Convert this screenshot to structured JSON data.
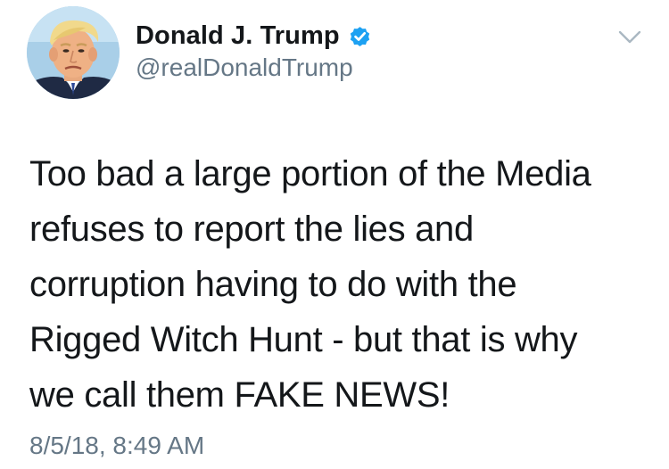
{
  "author": {
    "display_name": "Donald J. Trump",
    "handle": "@realDonaldTrump",
    "verified": true,
    "verified_icon": "verified-badge-icon",
    "avatar_icon": "profile-photo"
  },
  "menu": {
    "icon": "chevron-down-icon"
  },
  "tweet": {
    "lines": [
      "Too bad a large portion of the Media",
      "refuses to report the lies and",
      "corruption having to do with the",
      "Rigged Witch Hunt - but that is why",
      "we call them FAKE NEWS!"
    ],
    "timestamp": "8/5/18, 8:49 AM"
  },
  "colors": {
    "text": "#14171a",
    "secondary": "#657786",
    "verified_blue": "#1da1f2",
    "caret": "#aab8c2"
  }
}
